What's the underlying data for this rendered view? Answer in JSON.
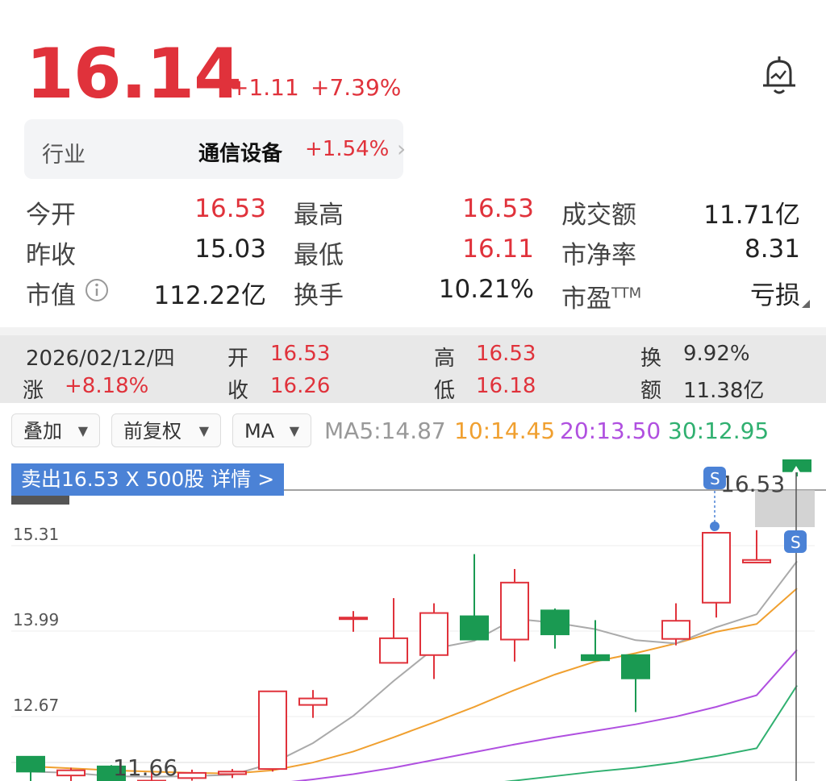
{
  "quote": {
    "price": "16.14",
    "change": "+1.11",
    "change_pct": "+7.39%"
  },
  "industry": {
    "label": "行业",
    "name": "通信设备",
    "change_pct": "+1.54%"
  },
  "stats": [
    {
      "label": "今开",
      "value": "16.53"
    },
    {
      "label": "最高",
      "value": "16.53"
    },
    {
      "label": "成交额",
      "value": "11.71亿"
    },
    {
      "label": "昨收",
      "value": "15.03"
    },
    {
      "label": "最低",
      "value": "16.11"
    },
    {
      "label": "市净率",
      "value": "8.31"
    },
    {
      "label": "市值",
      "value": "112.22亿"
    },
    {
      "label": "换手",
      "value": "10.21%"
    },
    {
      "label": "市盈",
      "sup": "TTM",
      "value": "亏损"
    }
  ],
  "day_info": {
    "date": "2026/02/12/四",
    "open_label": "开",
    "open": "16.53",
    "high_label": "高",
    "high": "16.53",
    "turnover_label": "换",
    "turnover": "9.92%",
    "change_label": "涨",
    "change": "+8.18%",
    "close_label": "收",
    "close": "16.26",
    "low_label": "低",
    "low": "16.18",
    "amount_label": "额",
    "amount": "11.38亿"
  },
  "controls": {
    "overlay": "叠加",
    "adjust": "前复权",
    "indicator": "MA"
  },
  "ma_values": {
    "ma5": "MA5:14.87",
    "ma10": "10:14.45",
    "ma20": "20:13.50",
    "ma30": "30:12.95"
  },
  "trade_banner": "卖出16.53 X 500股  详情 >",
  "colors": {
    "up": "#e0323b",
    "down": "#1a9a52",
    "ma5": "#aaaaaa",
    "ma10": "#f0a030",
    "ma20": "#b050e0",
    "ma30": "#30b070"
  },
  "chart_data": {
    "type": "candlestick",
    "y_ticks": [
      "15.31",
      "13.99",
      "12.67"
    ],
    "y_tick_values": [
      15.31,
      13.99,
      12.67
    ],
    "max_label": "16.53",
    "min_label": "11.66",
    "marker_label": "S",
    "candles": [
      {
        "o": 11.85,
        "c": 11.62,
        "h": 11.86,
        "l": 11.45
      },
      {
        "o": 11.56,
        "c": 11.64,
        "h": 11.68,
        "l": 11.42
      },
      {
        "o": 11.7,
        "c": 11.4,
        "h": 11.72,
        "l": 11.38
      },
      {
        "o": 11.4,
        "c": 11.48,
        "h": 11.66,
        "l": 11.35
      },
      {
        "o": 11.52,
        "c": 11.6,
        "h": 11.65,
        "l": 11.48
      },
      {
        "o": 11.58,
        "c": 11.62,
        "h": 11.66,
        "l": 11.52
      },
      {
        "o": 11.66,
        "c": 12.86,
        "h": 12.86,
        "l": 11.62
      },
      {
        "o": 12.65,
        "c": 12.75,
        "h": 12.88,
        "l": 12.45
      },
      {
        "o": 14.0,
        "c": 14.0,
        "h": 14.1,
        "l": 13.78
      },
      {
        "o": 13.3,
        "c": 13.68,
        "h": 14.3,
        "l": 13.3
      },
      {
        "o": 13.42,
        "c": 14.07,
        "h": 14.22,
        "l": 13.05
      },
      {
        "o": 14.02,
        "c": 13.66,
        "h": 14.98,
        "l": 13.66
      },
      {
        "o": 13.66,
        "c": 14.54,
        "h": 14.75,
        "l": 13.32
      },
      {
        "o": 14.11,
        "c": 13.74,
        "h": 14.14,
        "l": 13.52
      },
      {
        "o": 13.42,
        "c": 13.34,
        "h": 13.96,
        "l": 13.34
      },
      {
        "o": 13.42,
        "c": 13.06,
        "h": 13.42,
        "l": 12.54
      },
      {
        "o": 13.67,
        "c": 13.95,
        "h": 14.22,
        "l": 13.57
      },
      {
        "o": 14.23,
        "c": 15.31,
        "h": 15.31,
        "l": 14.0
      },
      {
        "o": 14.85,
        "c": 14.89,
        "h": 15.35,
        "l": 14.85
      },
      {
        "o": 16.53,
        "c": 16.26,
        "h": 16.53,
        "l": 16.18
      }
    ],
    "ma5": [
      11.62,
      11.6,
      11.55,
      11.54,
      11.55,
      11.57,
      11.75,
      12.06,
      12.48,
      13.02,
      13.52,
      13.64,
      13.98,
      13.92,
      13.82,
      13.65,
      13.6,
      13.85,
      14.05,
      14.87
    ],
    "ma10": [
      11.7,
      11.67,
      11.64,
      11.62,
      11.6,
      11.59,
      11.64,
      11.76,
      11.93,
      12.15,
      12.38,
      12.62,
      12.88,
      13.12,
      13.32,
      13.45,
      13.6,
      13.78,
      13.9,
      14.45
    ],
    "ma20": [
      11.3,
      11.3,
      11.32,
      11.34,
      11.36,
      11.38,
      11.43,
      11.5,
      11.58,
      11.68,
      11.8,
      11.92,
      12.04,
      12.15,
      12.25,
      12.35,
      12.47,
      12.62,
      12.8,
      13.5
    ],
    "ma30": [
      10.95,
      10.97,
      10.99,
      11.01,
      11.04,
      11.07,
      11.11,
      11.16,
      11.21,
      11.27,
      11.34,
      11.41,
      11.48,
      11.55,
      11.62,
      11.68,
      11.76,
      11.86,
      11.98,
      12.95
    ]
  }
}
